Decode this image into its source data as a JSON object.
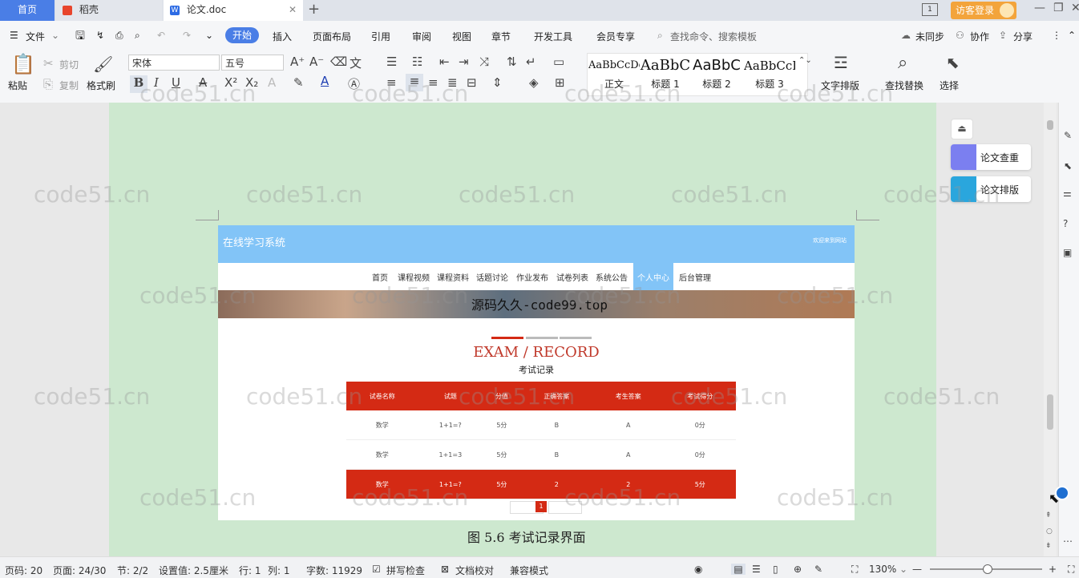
{
  "titlebar": {
    "tabs": [
      {
        "label": "首页"
      },
      {
        "label": "稻壳"
      },
      {
        "label": "论文.doc"
      }
    ],
    "login_label": "访客登录"
  },
  "menubar": {
    "file": "文件",
    "start": "开始",
    "items": [
      "插入",
      "页面布局",
      "引用",
      "审阅",
      "视图",
      "章节",
      "开发工具",
      "会员专享"
    ],
    "search_placeholder": "查找命令、搜索模板",
    "sync": "未同步",
    "collab": "协作",
    "share": "分享"
  },
  "ribbon": {
    "paste": "粘贴",
    "cut": "剪切",
    "copy": "复制",
    "format_painter": "格式刷",
    "font_name": "宋体",
    "font_size": "五号",
    "styles": [
      {
        "sample": "AaBbCcDd",
        "name": "正文"
      },
      {
        "sample": "AaBbC",
        "name": "标题 1"
      },
      {
        "sample": "AaBbC",
        "name": "标题 2"
      },
      {
        "sample": "AaBbCcI",
        "name": "标题 3"
      }
    ],
    "text_layout": "文字排版",
    "find_replace": "查找替换",
    "select": "选择"
  },
  "side_panel": {
    "check": "论文查重",
    "layout": "论文排版"
  },
  "embedded": {
    "site_title": "在线学习系统",
    "welcome": "欢迎来到网站",
    "nav": [
      "首页",
      "课程视频",
      "课程资料",
      "话题讨论",
      "作业发布",
      "试卷列表",
      "系统公告",
      "个人中心",
      "后台管理"
    ],
    "banner_text": "源码久久-code99.top",
    "exam_title": "EXAM / RECORD",
    "exam_subtitle": "考试记录",
    "table_headers": [
      "试卷名称",
      "试题",
      "分值",
      "正确答案",
      "考生答案",
      "考试得分"
    ],
    "table_rows": [
      [
        "数学",
        "1+1=?",
        "5分",
        "B",
        "A",
        "0分"
      ],
      [
        "数学",
        "1+1=3",
        "5分",
        "B",
        "A",
        "0分"
      ],
      [
        "数学",
        "1+1=?",
        "5分",
        "2",
        "2",
        "5分"
      ]
    ],
    "pagination_current": "1"
  },
  "caption": "图 5.6  考试记录界面",
  "statusbar": {
    "page_num": "页码: 20",
    "pages": "页面: 24/30",
    "section": "节: 2/2",
    "setting": "设置值: 2.5厘米",
    "row": "行: 1",
    "col": "列: 1",
    "words": "字数: 11929",
    "spell": "拼写检查",
    "proof": "文档校对",
    "compat": "兼容模式",
    "zoom": "130%"
  },
  "watermark": "code51.cn",
  "colors": {
    "accent": "#4a7ee6",
    "page_bg": "#cde8cf",
    "table_red": "#d42a14",
    "header_blue": "#82c4f7"
  }
}
